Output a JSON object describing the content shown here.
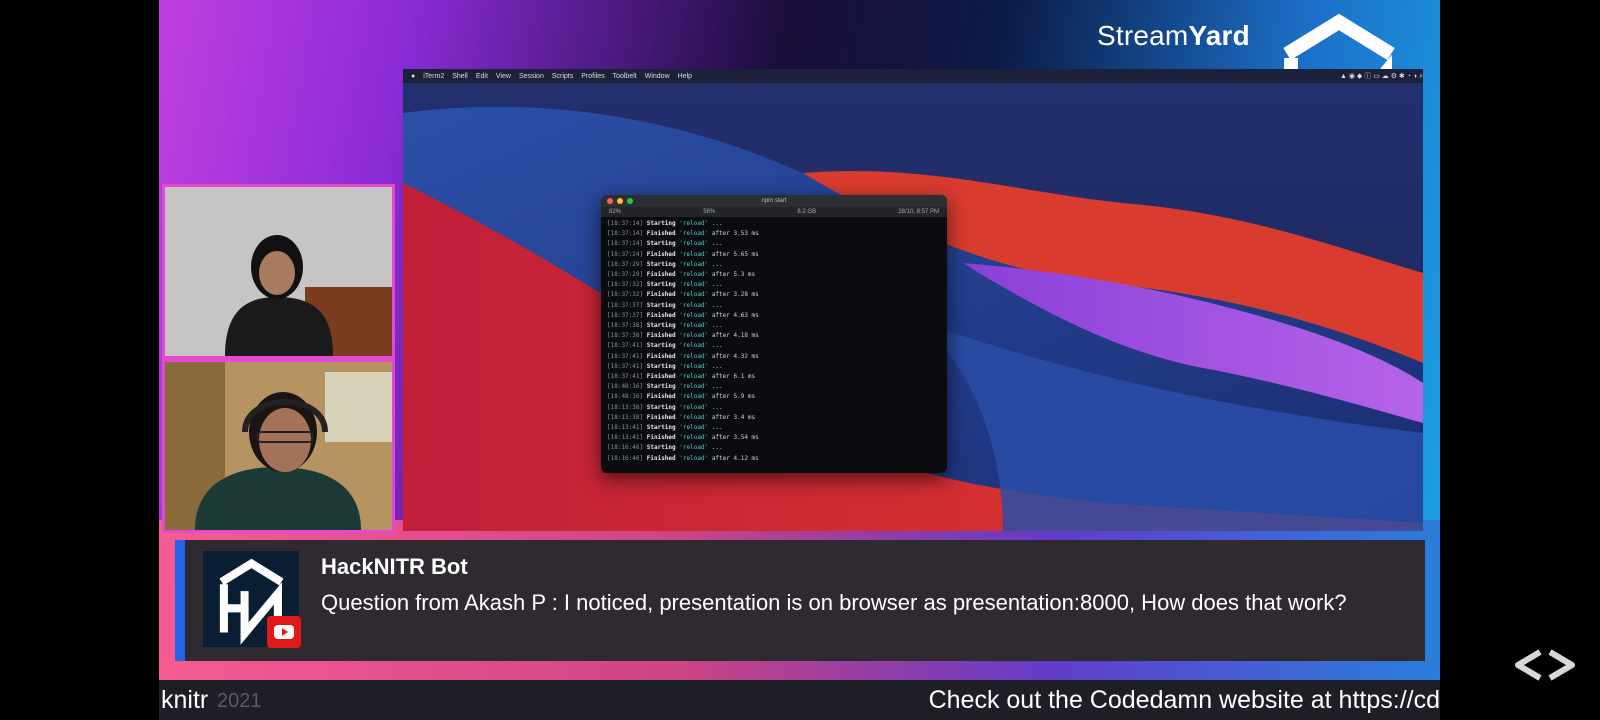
{
  "branding": {
    "streamyard_part1": "Stream",
    "streamyard_part2": "Yard"
  },
  "mac_menu": {
    "items": [
      "iTerm2",
      "Shell",
      "Edit",
      "View",
      "Session",
      "Scripts",
      "Profiles",
      "Toolbelt",
      "Window",
      "Help"
    ]
  },
  "terminal": {
    "title": "npm start",
    "status": [
      "82%",
      "58%",
      "8.2 GB",
      "28/10, 8:57 PM"
    ],
    "lines": [
      {
        "ts": "[18:37:14]",
        "verb": "Starting",
        "target": "'reload'",
        "tail": "..."
      },
      {
        "ts": "[18:37:14]",
        "verb": "Finished",
        "target": "'reload'",
        "tail": "after 3.53 ms"
      },
      {
        "ts": "[18:37:24]",
        "verb": "Starting",
        "target": "'reload'",
        "tail": "..."
      },
      {
        "ts": "[18:37:24]",
        "verb": "Finished",
        "target": "'reload'",
        "tail": "after 5.65 ms"
      },
      {
        "ts": "[18:37:29]",
        "verb": "Starting",
        "target": "'reload'",
        "tail": "..."
      },
      {
        "ts": "[18:37:29]",
        "verb": "Finished",
        "target": "'reload'",
        "tail": "after 5.3 ms"
      },
      {
        "ts": "[18:37:32]",
        "verb": "Starting",
        "target": "'reload'",
        "tail": "..."
      },
      {
        "ts": "[18:37:32]",
        "verb": "Finished",
        "target": "'reload'",
        "tail": "after 3.28 ms"
      },
      {
        "ts": "[18:37:37]",
        "verb": "Starting",
        "target": "'reload'",
        "tail": "..."
      },
      {
        "ts": "[18:37:37]",
        "verb": "Finished",
        "target": "'reload'",
        "tail": "after 4.63 ms"
      },
      {
        "ts": "[18:37:38]",
        "verb": "Starting",
        "target": "'reload'",
        "tail": "..."
      },
      {
        "ts": "[18:37:38]",
        "verb": "Finished",
        "target": "'reload'",
        "tail": "after 4.18 ms"
      },
      {
        "ts": "[18:37:41]",
        "verb": "Starting",
        "target": "'reload'",
        "tail": "..."
      },
      {
        "ts": "[18:37:41]",
        "verb": "Finished",
        "target": "'reload'",
        "tail": "after 4.32 ms"
      },
      {
        "ts": "[18:37:41]",
        "verb": "Starting",
        "target": "'reload'",
        "tail": "..."
      },
      {
        "ts": "[18:37:41]",
        "verb": "Finished",
        "target": "'reload'",
        "tail": "after 6.1 ms"
      },
      {
        "ts": "[18:48:16]",
        "verb": "Starting",
        "target": "'reload'",
        "tail": "..."
      },
      {
        "ts": "[18:48:16]",
        "verb": "Finished",
        "target": "'reload'",
        "tail": "after 5.9 ms"
      },
      {
        "ts": "[18:13:38]",
        "verb": "Starting",
        "target": "'reload'",
        "tail": "..."
      },
      {
        "ts": "[18:13:38]",
        "verb": "Finished",
        "target": "'reload'",
        "tail": "after 3.4 ms"
      },
      {
        "ts": "[18:13:41]",
        "verb": "Starting",
        "target": "'reload'",
        "tail": "..."
      },
      {
        "ts": "[18:13:41]",
        "verb": "Finished",
        "target": "'reload'",
        "tail": "after 3.54 ms"
      },
      {
        "ts": "[18:16:46]",
        "verb": "Starting",
        "target": "'reload'",
        "tail": "..."
      },
      {
        "ts": "[18:16:46]",
        "verb": "Finished",
        "target": "'reload'",
        "tail": "after 4.12 ms"
      }
    ]
  },
  "banner": {
    "name": "HackNITR Bot",
    "message": "Question from Akash P : I noticed, presentation is on browser as presentation:8000, How does that work?"
  },
  "ticker": {
    "left": "knitr",
    "mid": "2021",
    "right": "Check out the Codedamn website at https://cd"
  },
  "colors": {
    "accent_border": "#e24ad0",
    "banner_stripe": "#2563eb",
    "youtube_red": "#e01a1a"
  },
  "icons": [
    "hn-logo-icon",
    "youtube-icon",
    "nav-arrows-icon"
  ]
}
